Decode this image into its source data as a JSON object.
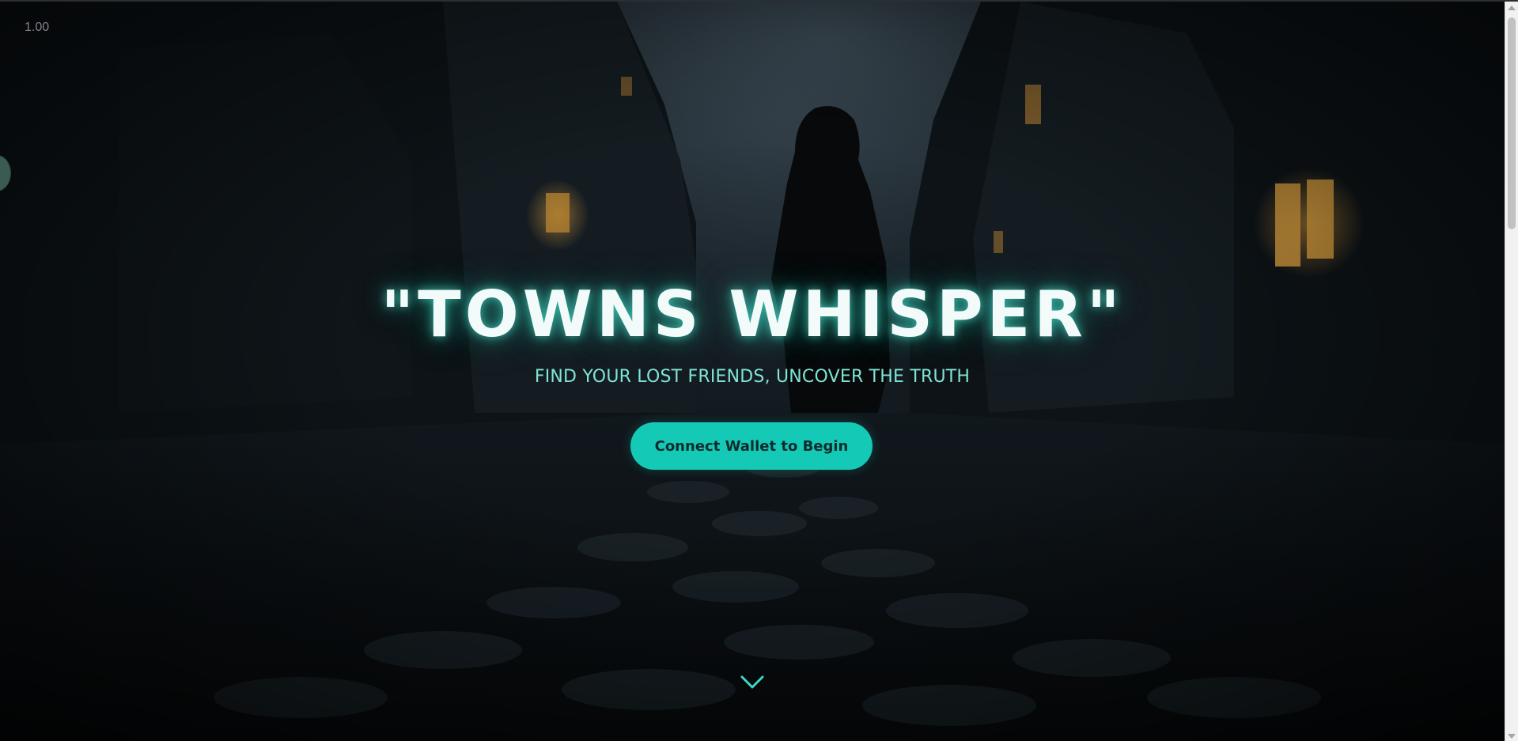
{
  "zoom": {
    "label": "1.00"
  },
  "hero": {
    "title": "\"TOWNS WHISPER\"",
    "subtitle": "FIND YOUR LOST FRIENDS, UNCOVER THE TRUTH",
    "cta_label": "Connect Wallet to Begin"
  },
  "icons": {
    "scroll_down": "chevron-down-icon",
    "side_widget": "circle-widget-icon"
  },
  "colors": {
    "accent": "#14c9b6",
    "subtitle": "#7ee4d6",
    "title_glow": "#48dcc8",
    "background": "#0b0f12"
  }
}
